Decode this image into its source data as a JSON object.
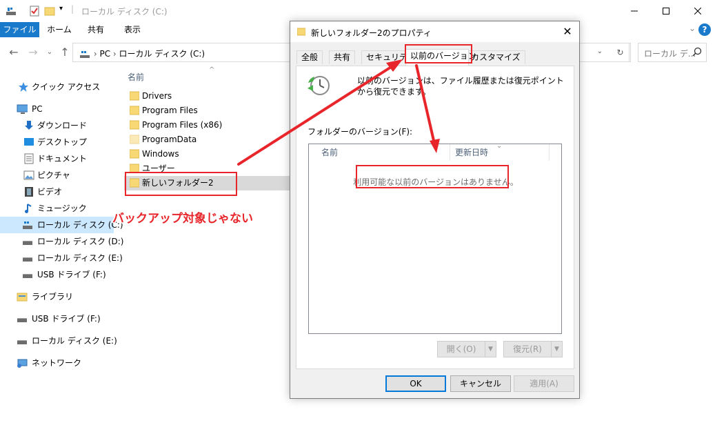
{
  "window": {
    "title": "ローカル ディスク (C:)"
  },
  "ribbon": {
    "tabs": [
      "ファイル",
      "ホーム",
      "共有",
      "表示"
    ]
  },
  "address": {
    "path": [
      "PC",
      "ローカル ディスク (C:)"
    ],
    "search_placeholder": "ローカル デ..."
  },
  "navpane": {
    "items": [
      {
        "label": "クイック アクセス",
        "icon": "star-icon"
      },
      {
        "label": "PC",
        "icon": "pc-icon"
      },
      {
        "label": "ダウンロード",
        "icon": "download-icon"
      },
      {
        "label": "デスクトップ",
        "icon": "desktop-icon"
      },
      {
        "label": "ドキュメント",
        "icon": "document-icon"
      },
      {
        "label": "ピクチャ",
        "icon": "picture-icon"
      },
      {
        "label": "ビデオ",
        "icon": "video-icon"
      },
      {
        "label": "ミュージック",
        "icon": "music-icon"
      },
      {
        "label": "ローカル ディスク (C:)",
        "icon": "drive-icon",
        "selected": true
      },
      {
        "label": "ローカル ディスク (D:)",
        "icon": "drive-icon"
      },
      {
        "label": "ローカル ディスク (E:)",
        "icon": "drive-icon"
      },
      {
        "label": "USB ドライブ (F:)",
        "icon": "usb-drive-icon"
      },
      {
        "label": "ライブラリ",
        "icon": "library-icon"
      },
      {
        "label": "USB ドライブ (F:)",
        "icon": "usb-drive-icon"
      },
      {
        "label": "ローカル ディスク (E:)",
        "icon": "drive-icon"
      },
      {
        "label": "ネットワーク",
        "icon": "network-icon"
      }
    ]
  },
  "filelist": {
    "column_name": "名前",
    "items": [
      {
        "name": "Drivers"
      },
      {
        "name": "Program Files"
      },
      {
        "name": "Program Files (x86)"
      },
      {
        "name": "ProgramData",
        "hidden": true
      },
      {
        "name": "Windows"
      },
      {
        "name": "ユーザー"
      },
      {
        "name": "新しいフォルダー2",
        "selected": true
      }
    ]
  },
  "dialog": {
    "title": "新しいフォルダー2のプロパティ",
    "tabs": [
      "全般",
      "共有",
      "セキュリティ",
      "以前のバージョン",
      "カスタマイズ"
    ],
    "active_tab": "以前のバージョン",
    "description": "以前のバージョンは、ファイル履歴または復元ポイントから復元できます。",
    "versions_label": "フォルダーのバージョン(F):",
    "columns": [
      "名前",
      "更新日時"
    ],
    "empty_message": "利用可能な以前のバージョンはありません。",
    "open_button": "開く(O)",
    "restore_button": "復元(R)",
    "ok_button": "OK",
    "cancel_button": "キャンセル",
    "apply_button": "適用(A)"
  },
  "annotation": {
    "text": "バックアップ対象じゃない",
    "color": "#e8252a"
  },
  "colors": {
    "accent": "#1979ca",
    "selection": "#cce8ff",
    "folder": "#f8d775"
  }
}
